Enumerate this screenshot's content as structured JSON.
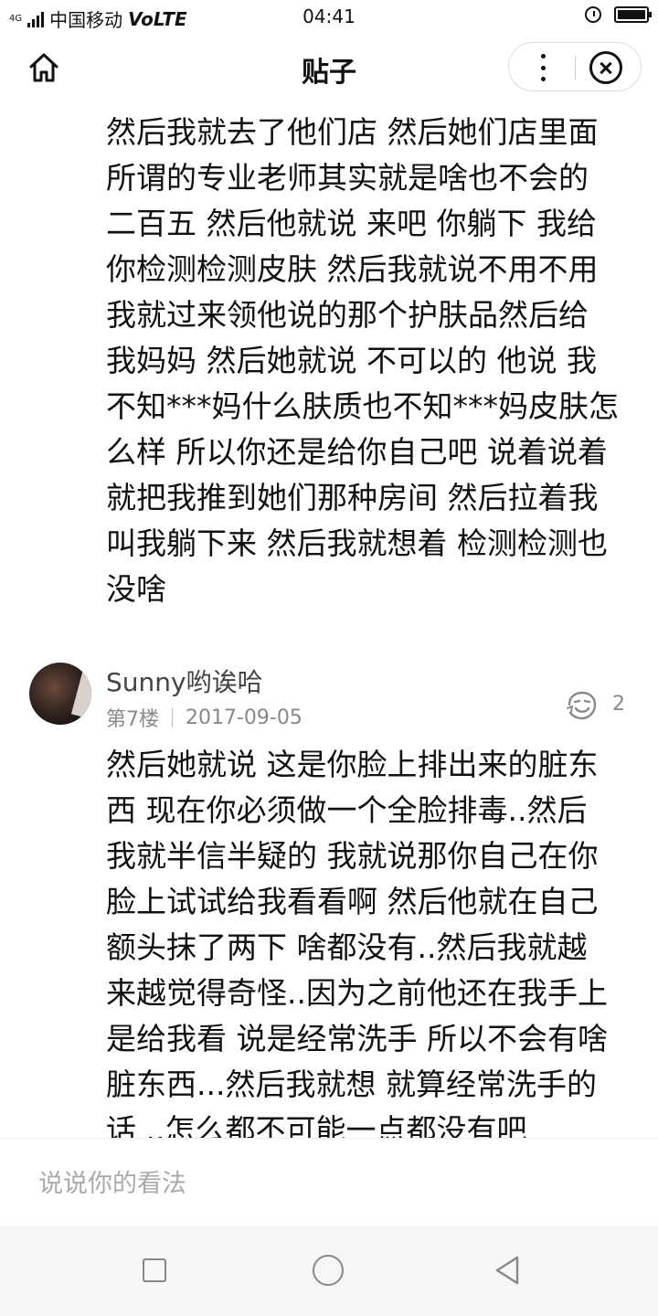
{
  "status_bar": {
    "network": "4G",
    "carrier": "中国移动",
    "volte": "VoLTE",
    "time": "04:41"
  },
  "header": {
    "title": "贴子",
    "icons": [
      "home-icon",
      "more-icon",
      "close-icon"
    ]
  },
  "post_continued": {
    "lines": [
      "然后我就去了他们店 然后她们店里面",
      "所谓的专业老师其实就是啥也不会的",
      "二百五 然后他就说 来吧 你躺下 我给",
      "你检测检测皮肤 然后我就说不用不用",
      "我就过来领他说的那个护肤品然后给",
      "我妈妈 然后她就说 不可以的 他说 我",
      "不知***妈什么肤质也不知***妈皮肤怎",
      "么样 所以你还是给你自己吧 说着说着",
      "就把我推到她们那种房间 然后拉着我",
      "叫我躺下来 然后我就想着 检测检测也",
      "没啥"
    ]
  },
  "reply": {
    "username": "Sunny哟诶哈",
    "floor": "第7楼",
    "date": "2017-09-05",
    "like_count": "2",
    "lines": [
      "然后她就说 这是你脸上排出来的脏东",
      "西 现在你必须做一个全脸排毒..然后",
      "我就半信半疑的 我就说那你自己在你",
      "脸上试试给我看看啊 然后他就在自己",
      "额头抹了两下 啥都没有..然后我就越",
      "来越觉得奇怪..因为之前他还在我手上",
      "是给我看 说是经常洗手 所以不会有啥",
      "脏东西...然后我就想 就算经常洗手的",
      "话 ..怎么都不可能一点都没有吧"
    ]
  },
  "comment_input": {
    "placeholder": "说说你的看法"
  },
  "nav_bar": {
    "icons": [
      "recent-apps-icon",
      "home-circle-icon",
      "back-triangle-icon"
    ]
  }
}
